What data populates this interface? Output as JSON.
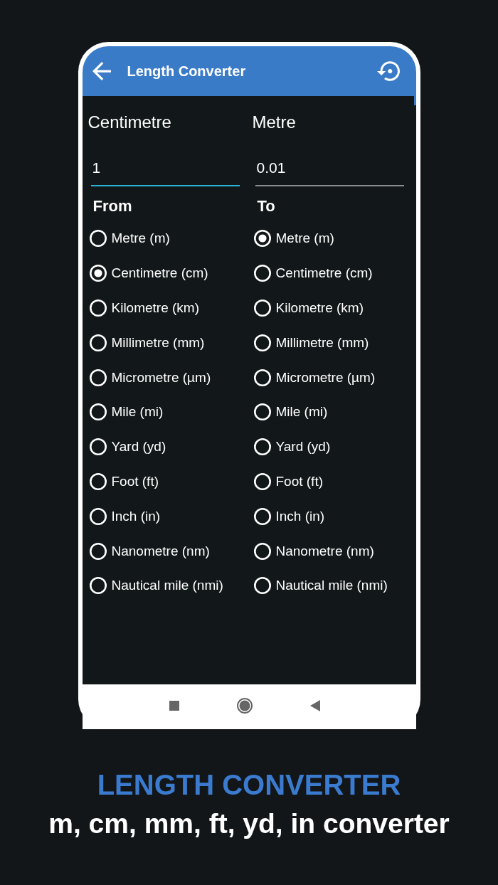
{
  "app_bar": {
    "title": "Length Converter"
  },
  "converter": {
    "columns": [
      {
        "unit_label": "Centimetre",
        "value": "1",
        "focused": true,
        "heading": "From",
        "options": [
          {
            "label": "Metre (m)",
            "selected": false
          },
          {
            "label": "Centimetre (cm)",
            "selected": true
          },
          {
            "label": "Kilometre (km)",
            "selected": false
          },
          {
            "label": "Millimetre (mm)",
            "selected": false
          },
          {
            "label": "Micrometre (µm)",
            "selected": false
          },
          {
            "label": "Mile (mi)",
            "selected": false
          },
          {
            "label": "Yard (yd)",
            "selected": false
          },
          {
            "label": "Foot (ft)",
            "selected": false
          },
          {
            "label": "Inch (in)",
            "selected": false
          },
          {
            "label": "Nanometre (nm)",
            "selected": false
          },
          {
            "label": "Nautical mile (nmi)",
            "selected": false
          }
        ]
      },
      {
        "unit_label": "Metre",
        "value": "0.01",
        "focused": false,
        "heading": "To",
        "options": [
          {
            "label": "Metre (m)",
            "selected": true
          },
          {
            "label": "Centimetre (cm)",
            "selected": false
          },
          {
            "label": "Kilometre (km)",
            "selected": false
          },
          {
            "label": "Millimetre (mm)",
            "selected": false
          },
          {
            "label": "Micrometre (µm)",
            "selected": false
          },
          {
            "label": "Mile (mi)",
            "selected": false
          },
          {
            "label": "Yard (yd)",
            "selected": false
          },
          {
            "label": "Foot (ft)",
            "selected": false
          },
          {
            "label": "Inch (in)",
            "selected": false
          },
          {
            "label": "Nanometre (nm)",
            "selected": false
          },
          {
            "label": "Nautical mile (nmi)",
            "selected": false
          }
        ]
      }
    ]
  },
  "promo": {
    "title": "LENGTH CONVERTER",
    "subtitle": "m, cm, mm, ft, yd, in converter"
  }
}
